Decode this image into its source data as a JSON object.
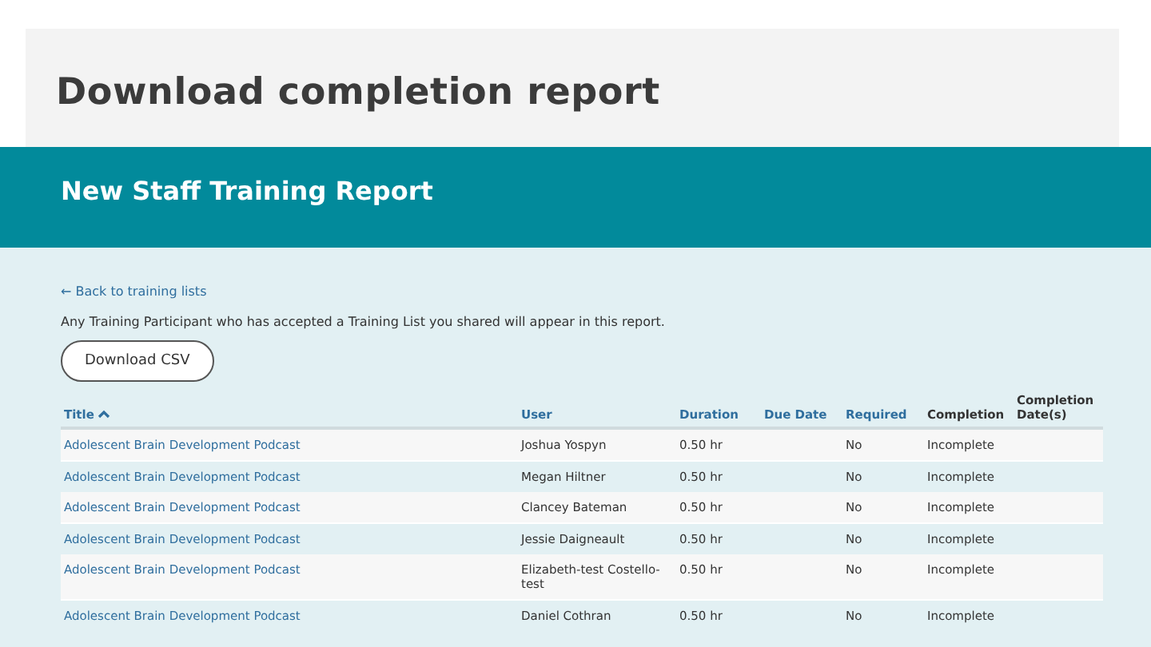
{
  "slide_title": "Download completion report",
  "banner": {
    "title": "New Staff Training Report"
  },
  "back_link": "← Back to training lists",
  "description": "Any Training Participant who has accepted a Training List you shared will appear in this report.",
  "download_button": "Download CSV",
  "table": {
    "columns": [
      {
        "label": "Title",
        "sortable": true,
        "sorted": true
      },
      {
        "label": "User",
        "sortable": true,
        "sorted": false
      },
      {
        "label": "Duration",
        "sortable": true,
        "sorted": false
      },
      {
        "label": "Due Date",
        "sortable": true,
        "sorted": false
      },
      {
        "label": "Required",
        "sortable": true,
        "sorted": false
      },
      {
        "label": "Completion",
        "sortable": false,
        "sorted": false
      },
      {
        "label": "Completion Date(s)",
        "sortable": false,
        "sorted": false
      }
    ],
    "rows": [
      [
        "Adolescent Brain Development Podcast",
        "Joshua Yospyn",
        "0.50 hr",
        "",
        "No",
        "Incomplete",
        ""
      ],
      [
        "Adolescent Brain Development Podcast",
        "Megan Hiltner",
        "0.50 hr",
        "",
        "No",
        "Incomplete",
        ""
      ],
      [
        "Adolescent Brain Development Podcast",
        "Clancey Bateman",
        "0.50 hr",
        "",
        "No",
        "Incomplete",
        ""
      ],
      [
        "Adolescent Brain Development Podcast",
        "Jessie Daigneault",
        "0.50 hr",
        "",
        "No",
        "Incomplete",
        ""
      ],
      [
        "Adolescent Brain Development Podcast",
        "Elizabeth-test Costello-test",
        "0.50 hr",
        "",
        "No",
        "Incomplete",
        ""
      ],
      [
        "Adolescent Brain Development Podcast",
        "Daniel Cothran",
        "0.50 hr",
        "",
        "No",
        "Incomplete",
        ""
      ]
    ]
  }
}
